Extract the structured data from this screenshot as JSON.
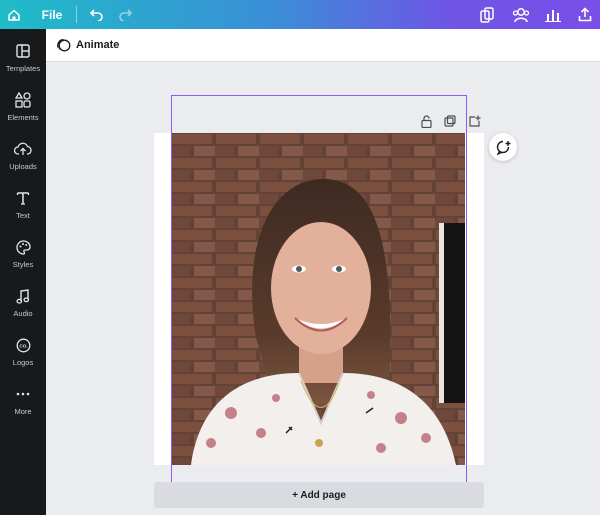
{
  "topbar": {
    "file_label": "File",
    "icons": [
      "home-icon",
      "undo-icon",
      "redo-icon",
      "resize-icon",
      "share-people-icon",
      "insights-icon",
      "download-icon"
    ]
  },
  "sidebar": {
    "items": [
      {
        "label": "Templates",
        "icon": "templates-icon"
      },
      {
        "label": "Elements",
        "icon": "elements-icon"
      },
      {
        "label": "Uploads",
        "icon": "cloud-upload-icon"
      },
      {
        "label": "Text",
        "icon": "text-icon"
      },
      {
        "label": "Styles",
        "icon": "palette-icon"
      },
      {
        "label": "Audio",
        "icon": "music-note-icon"
      },
      {
        "label": "Logos",
        "icon": "logos-icon"
      },
      {
        "label": "More",
        "icon": "more-dots-icon"
      }
    ]
  },
  "animate": {
    "label": "Animate"
  },
  "canvas": {
    "add_page_label": "+ Add page",
    "image": "portrait-photo"
  },
  "colors": {
    "selection": "#8b5cf6",
    "sidebar_bg": "#18191b",
    "gradient_start": "#1fbcc8",
    "gradient_end": "#7a4fe8"
  }
}
